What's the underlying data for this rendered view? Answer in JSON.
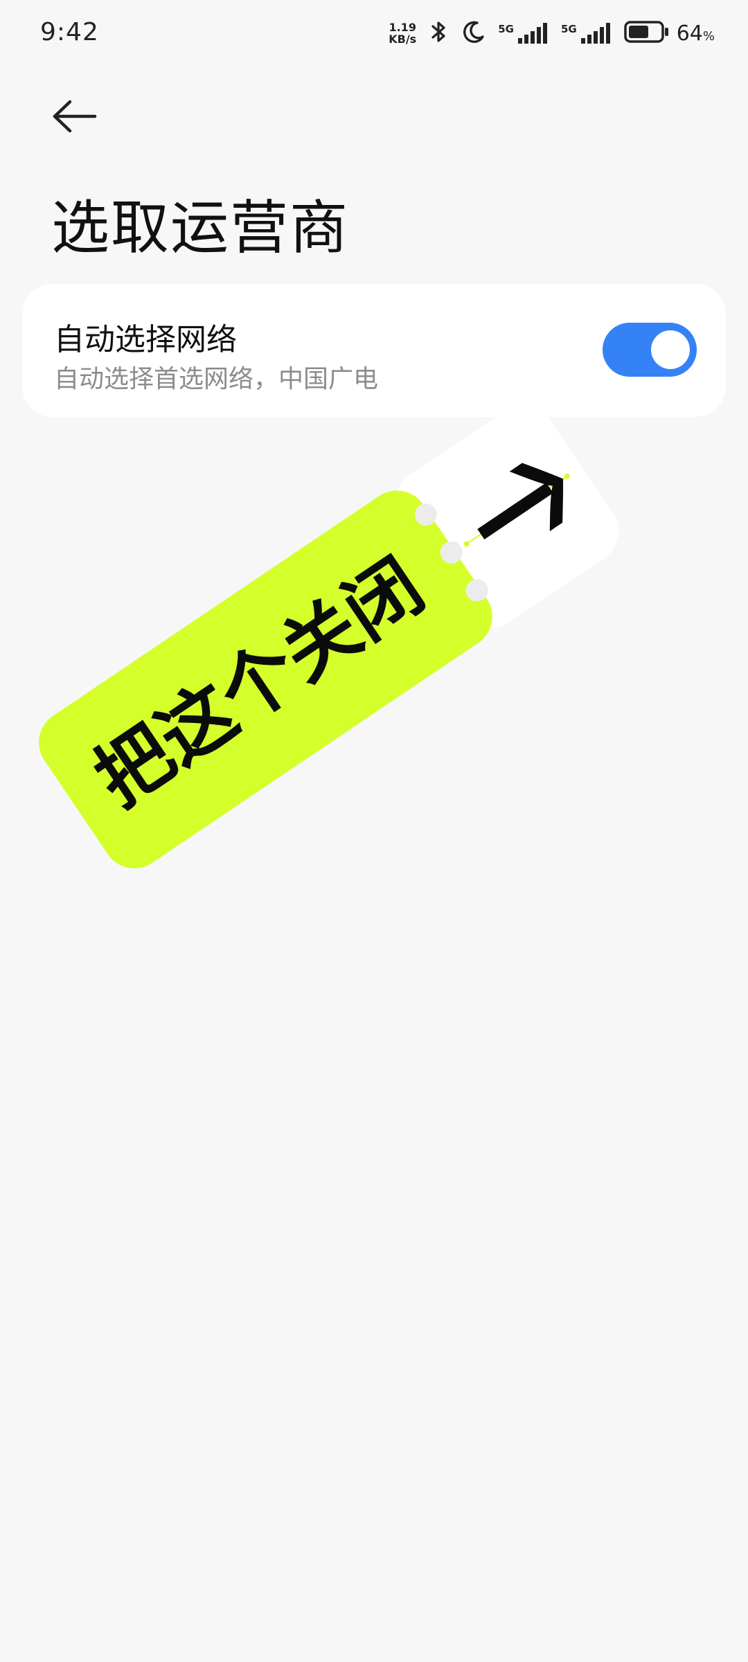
{
  "status_bar": {
    "time": "9:42",
    "net_speed_value": "1.19",
    "net_speed_unit": "KB/s",
    "sim1_label": "5G",
    "sim2_label": "5G",
    "battery_value": "64",
    "battery_unit": "%",
    "battery_level": 0.64,
    "icons": [
      "bluetooth-icon",
      "moon-icon",
      "signal-icon",
      "battery-icon"
    ]
  },
  "page": {
    "title": "选取运营商"
  },
  "auto_network": {
    "title": "自动选择网络",
    "subtitle": "自动选择首选网络，中国广电",
    "enabled": true
  },
  "sticker": {
    "text": "把这个关闭"
  },
  "colors": {
    "background": "#f7f7f7",
    "card": "#ffffff",
    "toggle_on": "#3482f6",
    "sticker": "#d4ff2a"
  }
}
